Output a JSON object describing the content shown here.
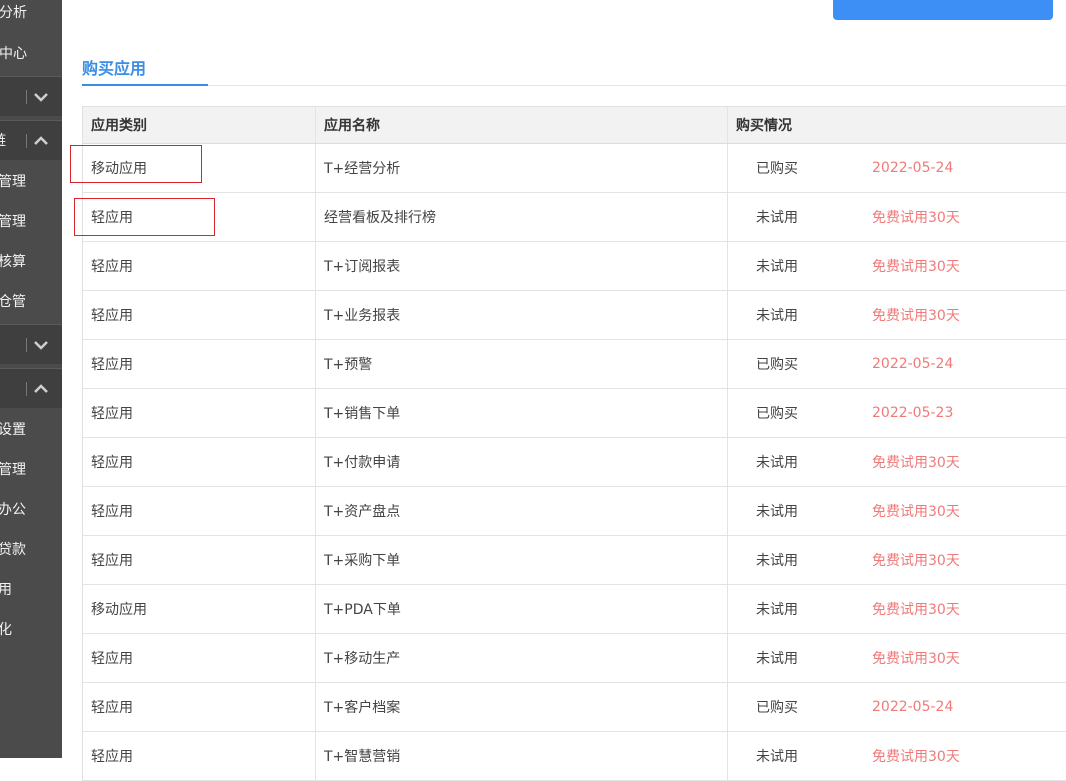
{
  "sidebar": {
    "items": [
      {
        "label": "分析",
        "kind": "item"
      },
      {
        "label": "中心",
        "kind": "item"
      },
      {
        "label": "",
        "kind": "group",
        "chevron": "down"
      },
      {
        "label": "链",
        "kind": "group",
        "chevron": "up"
      },
      {
        "label": "管理",
        "kind": "item"
      },
      {
        "label": "管理",
        "kind": "item"
      },
      {
        "label": "核算",
        "kind": "item"
      },
      {
        "label": "仓管",
        "kind": "item"
      },
      {
        "label": "",
        "kind": "group",
        "chevron": "down"
      },
      {
        "label": "",
        "kind": "group",
        "chevron": "up"
      },
      {
        "label": "设置",
        "kind": "item"
      },
      {
        "label": "管理",
        "kind": "item"
      },
      {
        "label": "办公",
        "kind": "item"
      },
      {
        "label": "贷款",
        "kind": "item"
      },
      {
        "label": "用",
        "kind": "item"
      },
      {
        "label": "化",
        "kind": "item"
      }
    ]
  },
  "section": {
    "title": "购买应用"
  },
  "table": {
    "headers": [
      "应用类别",
      "应用名称",
      "购买情况"
    ],
    "rows": [
      {
        "category": "移动应用",
        "name": "T+经营分析",
        "status": "已购买",
        "extra": "2022-05-24"
      },
      {
        "category": "轻应用",
        "name": "经营看板及排行榜",
        "status": "未试用",
        "extra": "免费试用30天"
      },
      {
        "category": "轻应用",
        "name": "T+订阅报表",
        "status": "未试用",
        "extra": "免费试用30天"
      },
      {
        "category": "轻应用",
        "name": "T+业务报表",
        "status": "未试用",
        "extra": "免费试用30天"
      },
      {
        "category": "轻应用",
        "name": "T+预警",
        "status": "已购买",
        "extra": "2022-05-24"
      },
      {
        "category": "轻应用",
        "name": "T+销售下单",
        "status": "已购买",
        "extra": "2022-05-23"
      },
      {
        "category": "轻应用",
        "name": "T+付款申请",
        "status": "未试用",
        "extra": "免费试用30天"
      },
      {
        "category": "轻应用",
        "name": "T+资产盘点",
        "status": "未试用",
        "extra": "免费试用30天"
      },
      {
        "category": "轻应用",
        "name": "T+采购下单",
        "status": "未试用",
        "extra": "免费试用30天"
      },
      {
        "category": "移动应用",
        "name": "T+PDA下单",
        "status": "未试用",
        "extra": "免费试用30天"
      },
      {
        "category": "轻应用",
        "name": "T+移动生产",
        "status": "未试用",
        "extra": "免费试用30天"
      },
      {
        "category": "轻应用",
        "name": "T+客户档案",
        "status": "已购买",
        "extra": "2022-05-24"
      },
      {
        "category": "轻应用",
        "name": "T+智慧营销",
        "status": "未试用",
        "extra": "免费试用30天"
      }
    ]
  },
  "colors": {
    "accent": "#3a8ee6",
    "link_red": "#f07a7a",
    "annotation": "#d8262c",
    "sidebar_bg": "#4b4b4b"
  }
}
